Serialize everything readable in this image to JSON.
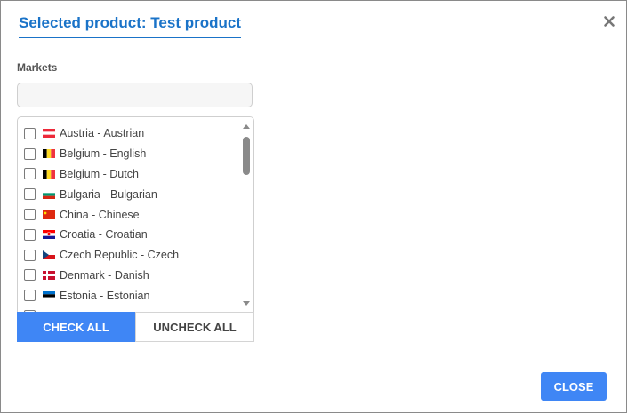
{
  "dialog": {
    "title": "Selected product: Test product",
    "close_icon": "close-icon",
    "close_button_label": "CLOSE"
  },
  "markets": {
    "label": "Markets",
    "filter": {
      "value": "",
      "placeholder": ""
    },
    "items": [
      {
        "label": "Austria - Austrian",
        "flag": "flag-austria-icon",
        "checked": false
      },
      {
        "label": "Belgium - English",
        "flag": "flag-belgium-icon",
        "checked": false
      },
      {
        "label": "Belgium - Dutch",
        "flag": "flag-belgium-icon",
        "checked": false
      },
      {
        "label": "Bulgaria - Bulgarian",
        "flag": "flag-bulgaria-icon",
        "checked": false
      },
      {
        "label": "China - Chinese",
        "flag": "flag-china-icon",
        "checked": false
      },
      {
        "label": "Croatia - Croatian",
        "flag": "flag-croatia-icon",
        "checked": false
      },
      {
        "label": "Czech Republic - Czech",
        "flag": "flag-czech-republic-icon",
        "checked": false
      },
      {
        "label": "Denmark - Danish",
        "flag": "flag-denmark-icon",
        "checked": false
      },
      {
        "label": "Estonia - Estonian",
        "flag": "flag-estonia-icon",
        "checked": false
      }
    ],
    "check_all_label": "CHECK ALL",
    "uncheck_all_label": "UNCHECK ALL"
  },
  "colors": {
    "accent": "#3f86f5",
    "title": "#1a73c8"
  }
}
